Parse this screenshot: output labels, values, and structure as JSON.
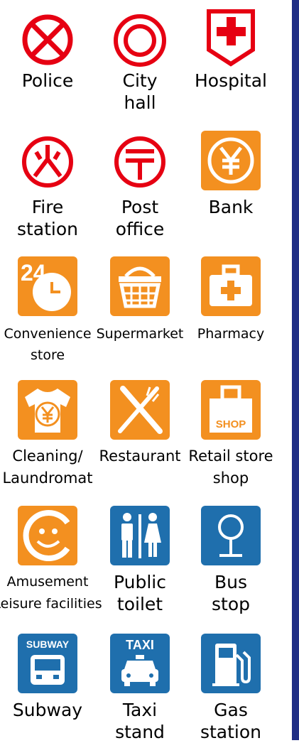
{
  "colors": {
    "red": "#e60012",
    "orange": "#f39020",
    "blue": "#1f6fad",
    "navy_bar": "#1f2e85"
  },
  "items": [
    {
      "icon": "cross-circle-icon",
      "line1": "Police",
      "line2": ""
    },
    {
      "icon": "double-circle-icon",
      "line1": "City",
      "line2": "hall"
    },
    {
      "icon": "red-cross-shield-icon",
      "line1": "Hospital",
      "line2": ""
    },
    {
      "icon": "fire-symbol-icon",
      "line1": "Fire",
      "line2": "station"
    },
    {
      "icon": "post-mark-icon",
      "line1": "Post",
      "line2": "office"
    },
    {
      "icon": "yen-icon",
      "line1": "Bank",
      "line2": ""
    },
    {
      "icon": "24h-clock-icon",
      "line1": "Convenience",
      "line2": "store",
      "badge": "24"
    },
    {
      "icon": "basket-icon",
      "line1": "Supermarket",
      "line2": ""
    },
    {
      "icon": "medical-bag-icon",
      "line1": "Pharmacy",
      "line2": ""
    },
    {
      "icon": "shirt-yen-icon",
      "line1": "Cleaning∕",
      "line2": "Laundromat"
    },
    {
      "icon": "fork-knife-icon",
      "line1": "Restaurant",
      "line2": ""
    },
    {
      "icon": "shop-bag-icon",
      "line1": "Retail store",
      "line2": "shop",
      "badge": "SHOP"
    },
    {
      "icon": "smiley-icon",
      "line1": "Amusement",
      "line2": "Leisure facilities"
    },
    {
      "icon": "restroom-icon",
      "line1": "Public",
      "line2": "toilet"
    },
    {
      "icon": "bus-stop-icon",
      "line1": "Bus",
      "line2": "stop"
    },
    {
      "icon": "subway-icon",
      "line1": "Subway",
      "line2": "",
      "badge": "SUBWAY"
    },
    {
      "icon": "taxi-icon",
      "line1": "Taxi",
      "line2": "stand",
      "badge": "TAXI"
    },
    {
      "icon": "gas-pump-icon",
      "line1": "Gas",
      "line2": "station"
    }
  ]
}
